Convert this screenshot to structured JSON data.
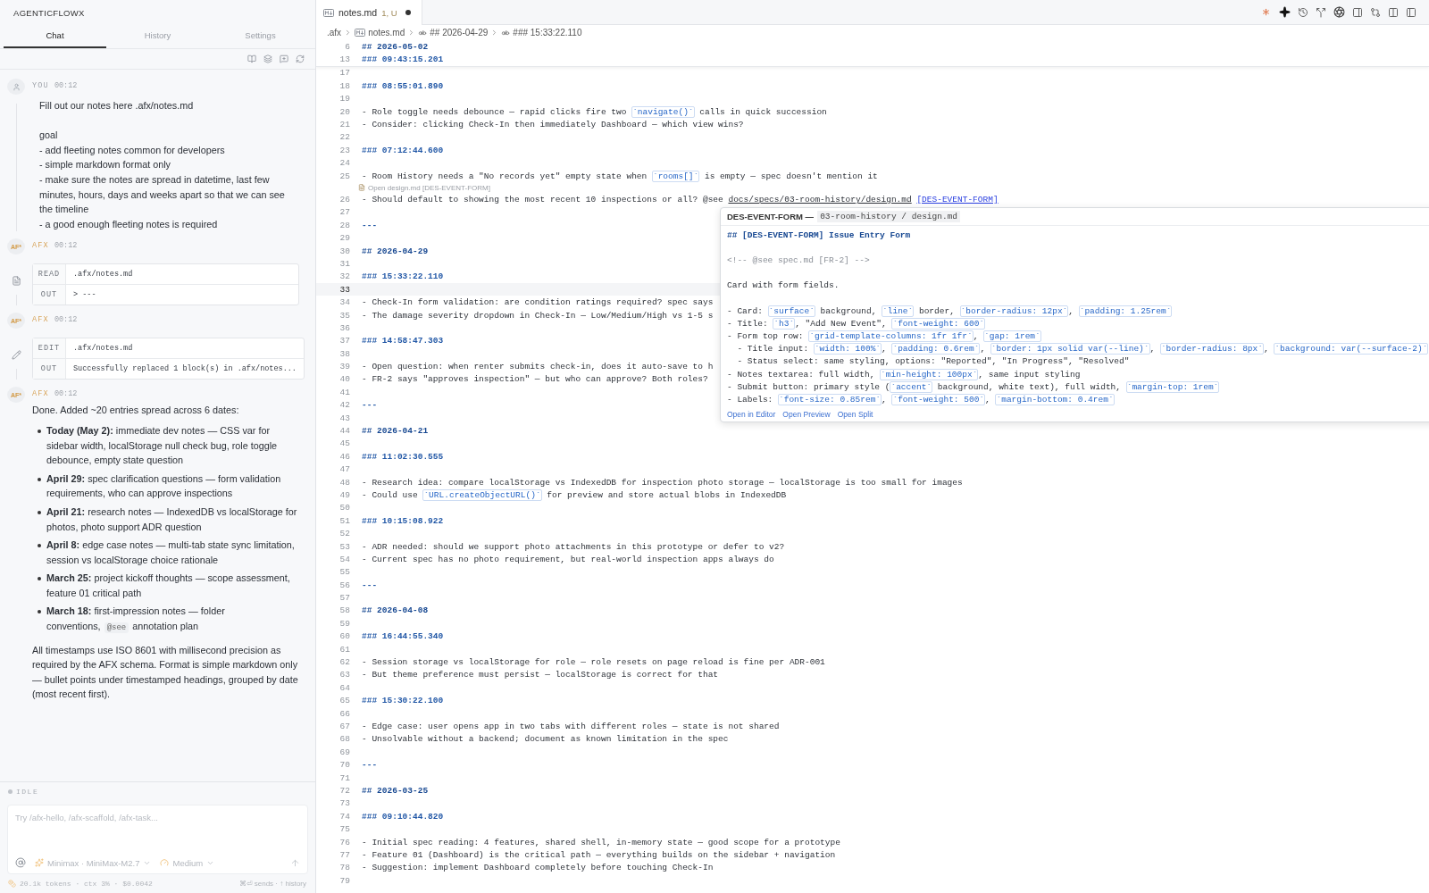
{
  "sidebar": {
    "title": "AGENTICFLOWX",
    "tabs": [
      {
        "label": "Chat",
        "selected": true
      },
      {
        "label": "History",
        "selected": false
      },
      {
        "label": "Settings",
        "selected": false
      }
    ],
    "messages": [
      {
        "kind": "user",
        "role": "YOU",
        "time": "00:12",
        "text": "Fill out our notes here .afx/notes.md\n\ngoal\n- add fleeting notes common for developers\n- simple markdown format only\n- make sure the notes are spread in datetime, last few minutes, hours, days and weeks apart so that we can see the timeline\n- a good enough fleeting notes is required"
      },
      {
        "kind": "read",
        "role": "AFX",
        "time": "00:12",
        "avatar": "AF*",
        "rows": [
          {
            "label": "READ",
            "value": ".afx/notes.md"
          },
          {
            "label": "OUT",
            "value": "> ---"
          }
        ]
      },
      {
        "kind": "edit",
        "role": "AFX",
        "time": "00:12",
        "avatar": "AF*",
        "rows": [
          {
            "label": "EDIT",
            "value": ".afx/notes.md"
          },
          {
            "label": "OUT",
            "value": "Successfully replaced 1 block(s) in .afx/notes..."
          }
        ]
      },
      {
        "kind": "assistant",
        "role": "AFX",
        "time": "00:12",
        "avatar": "AF*",
        "intro": "Done. Added ~20 entries spread across 6 dates:",
        "bullets": [
          {
            "parts": [
              {
                "kind": "text",
                "text": "**Today (May 2):** immediate dev notes — CSS var for sidebar width, localStorage null check bug, role toggle debounce, empty state question"
              }
            ]
          },
          {
            "parts": [
              {
                "kind": "text",
                "text": "**April 29:** spec clarification questions — form validation requirements, who can approve inspections"
              }
            ]
          },
          {
            "parts": [
              {
                "kind": "text",
                "text": "**April 21:** research notes — IndexedDB vs localStorage for photos, photo support ADR question"
              }
            ]
          },
          {
            "parts": [
              {
                "kind": "text",
                "text": "**April 8:** edge case notes — multi-tab state sync limitation, session vs localStorage choice rationale"
              }
            ]
          },
          {
            "parts": [
              {
                "kind": "text",
                "text": "**March 25:** project kickoff thoughts — scope assessment, feature 01 critical path"
              }
            ]
          },
          {
            "parts": [
              {
                "kind": "text",
                "text": "**March 18:** first-impression notes — folder conventions,"
              },
              {
                "kind": "code",
                "text": "@see"
              },
              {
                "kind": "text",
                "text": "annotation plan"
              }
            ]
          }
        ],
        "outro": "All timestamps use ISO 8601 with millisecond precision as required by the AFX schema. Format is simple markdown only — bullet points under timestamped headings, grouped by date (most recent first)."
      }
    ],
    "status": "IDLE",
    "composer": {
      "placeholder": "Try /afx-hello, /afx-scaffold, /afx-task...",
      "model": "Minimax · MiniMax-M2.7",
      "effort": "Medium"
    },
    "footer": {
      "usage": "20.1k tokens · ctx 3% · $0.0042",
      "hint": "⌘⏎ sends · ↑ history"
    }
  },
  "editor": {
    "tab": {
      "name": "notes.md",
      "status": "1, U",
      "modified": true
    },
    "breadcrumb": [
      {
        "kind": "folder",
        "text": ".afx"
      },
      {
        "kind": "file",
        "text": "notes.md"
      },
      {
        "kind": "symbol",
        "text": "## 2026-04-29"
      },
      {
        "kind": "symbol",
        "text": "### 15:33:22.110"
      }
    ],
    "sticky_lines": [
      {
        "n": "6",
        "parts": [
          {
            "kind": "h2",
            "text": "## 2026-05-02"
          }
        ]
      },
      {
        "n": "13",
        "parts": [
          {
            "kind": "h3",
            "text": "### 09:43:15.201"
          }
        ]
      }
    ],
    "lines": [
      {
        "n": "17",
        "current": false
      },
      {
        "n": "18",
        "current": false,
        "parts": [
          {
            "kind": "h3",
            "text": "### 08:55:01.890"
          }
        ]
      },
      {
        "n": "19",
        "current": false
      },
      {
        "n": "20",
        "current": false,
        "parts": [
          {
            "kind": "text",
            "text": "- Role toggle needs debounce — rapid clicks fire two "
          },
          {
            "kind": "code",
            "text": "`navigate()`"
          },
          {
            "kind": "text",
            "text": " calls in quick succession"
          }
        ]
      },
      {
        "n": "21",
        "current": false,
        "parts": [
          {
            "kind": "text",
            "text": "- Consider: clicking Check-In then immediately Dashboard — which view wins?"
          }
        ]
      },
      {
        "n": "22",
        "current": false
      },
      {
        "n": "23",
        "current": false,
        "parts": [
          {
            "kind": "h3",
            "text": "### 07:12:44.600"
          }
        ]
      },
      {
        "n": "24",
        "current": false
      },
      {
        "n": "25",
        "current": false,
        "parts": [
          {
            "kind": "text",
            "text": "- Room History needs a \"No records yet\" empty state when "
          },
          {
            "kind": "code",
            "text": "`rooms[]`"
          },
          {
            "kind": "text",
            "text": " is empty — spec doesn't mention it"
          }
        ]
      },
      {
        "n": "26",
        "current": false,
        "lens": "Open design.md [DES-EVENT-FORM]",
        "parts": [
          {
            "kind": "text",
            "text": "- Should default to showing the most recent 10 inspections or all? @see "
          },
          {
            "kind": "path",
            "text": "docs/specs/03-room-history/design.md"
          },
          {
            "kind": "ref",
            "text": "[DES-EVENT-FORM]"
          }
        ]
      },
      {
        "n": "27",
        "current": false
      },
      {
        "n": "28",
        "current": false,
        "parts": [
          {
            "kind": "hr",
            "text": "---"
          }
        ]
      },
      {
        "n": "29",
        "current": false
      },
      {
        "n": "30",
        "current": false,
        "parts": [
          {
            "kind": "h2",
            "text": "## 2026-04-29"
          }
        ]
      },
      {
        "n": "31",
        "current": false
      },
      {
        "n": "32",
        "current": false,
        "parts": [
          {
            "kind": "h3",
            "text": "### 15:33:22.110"
          }
        ]
      },
      {
        "n": "33",
        "current": true
      },
      {
        "n": "34",
        "current": false,
        "parts": [
          {
            "kind": "text",
            "text": "- Check-In form validation: are condition ratings required? spec says"
          }
        ]
      },
      {
        "n": "35",
        "current": false,
        "parts": [
          {
            "kind": "text",
            "text": "- The damage severity dropdown in Check-In — Low/Medium/High vs 1-5 s"
          }
        ]
      },
      {
        "n": "36",
        "current": false
      },
      {
        "n": "37",
        "current": false,
        "parts": [
          {
            "kind": "h3",
            "text": "### 14:58:47.303"
          }
        ]
      },
      {
        "n": "38",
        "current": false
      },
      {
        "n": "39",
        "current": false,
        "parts": [
          {
            "kind": "text",
            "text": "- Open question: when renter submits check-in, does it auto-save to h"
          }
        ]
      },
      {
        "n": "40",
        "current": false,
        "parts": [
          {
            "kind": "text",
            "text": "- FR-2 says \"approves inspection\" — but who can approve? Both roles?"
          }
        ]
      },
      {
        "n": "41",
        "current": false
      },
      {
        "n": "42",
        "current": false,
        "parts": [
          {
            "kind": "hr",
            "text": "---"
          }
        ]
      },
      {
        "n": "43",
        "current": false
      },
      {
        "n": "44",
        "current": false,
        "parts": [
          {
            "kind": "h2",
            "text": "## 2026-04-21"
          }
        ]
      },
      {
        "n": "45",
        "current": false
      },
      {
        "n": "46",
        "current": false,
        "parts": [
          {
            "kind": "h3",
            "text": "### 11:02:30.555"
          }
        ]
      },
      {
        "n": "47",
        "current": false
      },
      {
        "n": "48",
        "current": false,
        "parts": [
          {
            "kind": "text",
            "text": "- Research idea: compare localStorage vs IndexedDB for inspection photo storage — localStorage is too small for images"
          }
        ]
      },
      {
        "n": "49",
        "current": false,
        "parts": [
          {
            "kind": "text",
            "text": "- Could use "
          },
          {
            "kind": "code",
            "text": "`URL.createObjectURL()`"
          },
          {
            "kind": "text",
            "text": " for preview and store actual blobs in IndexedDB"
          }
        ]
      },
      {
        "n": "50",
        "current": false
      },
      {
        "n": "51",
        "current": false,
        "parts": [
          {
            "kind": "h3",
            "text": "### 10:15:08.922"
          }
        ]
      },
      {
        "n": "52",
        "current": false
      },
      {
        "n": "53",
        "current": false,
        "parts": [
          {
            "kind": "text",
            "text": "- ADR needed: should we support photo attachments in this prototype or defer to v2?"
          }
        ]
      },
      {
        "n": "54",
        "current": false,
        "parts": [
          {
            "kind": "text",
            "text": "- Current spec has no photo requirement, but real-world inspection apps always do"
          }
        ]
      },
      {
        "n": "55",
        "current": false
      },
      {
        "n": "56",
        "current": false,
        "parts": [
          {
            "kind": "hr",
            "text": "---"
          }
        ]
      },
      {
        "n": "57",
        "current": false
      },
      {
        "n": "58",
        "current": false,
        "parts": [
          {
            "kind": "h2",
            "text": "## 2026-04-08"
          }
        ]
      },
      {
        "n": "59",
        "current": false
      },
      {
        "n": "60",
        "current": false,
        "parts": [
          {
            "kind": "h3",
            "text": "### 16:44:55.340"
          }
        ]
      },
      {
        "n": "61",
        "current": false
      },
      {
        "n": "62",
        "current": false,
        "parts": [
          {
            "kind": "text",
            "text": "- Session storage vs localStorage for role — role resets on page reload is fine per ADR-001"
          }
        ]
      },
      {
        "n": "63",
        "current": false,
        "parts": [
          {
            "kind": "text",
            "text": "- But theme preference must persist — localStorage is correct for that"
          }
        ]
      },
      {
        "n": "64",
        "current": false
      },
      {
        "n": "65",
        "current": false,
        "parts": [
          {
            "kind": "h3",
            "text": "### 15:30:22.100"
          }
        ]
      },
      {
        "n": "66",
        "current": false
      },
      {
        "n": "67",
        "current": false,
        "parts": [
          {
            "kind": "text",
            "text": "- Edge case: user opens app in two tabs with different roles — state is not shared"
          }
        ]
      },
      {
        "n": "68",
        "current": false,
        "parts": [
          {
            "kind": "text",
            "text": "- Unsolvable without a backend; document as known limitation in the spec"
          }
        ]
      },
      {
        "n": "69",
        "current": false
      },
      {
        "n": "70",
        "current": false,
        "parts": [
          {
            "kind": "hr",
            "text": "---"
          }
        ]
      },
      {
        "n": "71",
        "current": false
      },
      {
        "n": "72",
        "current": false,
        "parts": [
          {
            "kind": "h2",
            "text": "## 2026-03-25"
          }
        ]
      },
      {
        "n": "73",
        "current": false
      },
      {
        "n": "74",
        "current": false,
        "parts": [
          {
            "kind": "h3",
            "text": "### 09:10:44.820"
          }
        ]
      },
      {
        "n": "75",
        "current": false
      },
      {
        "n": "76",
        "current": false,
        "parts": [
          {
            "kind": "text",
            "text": "- Initial spec reading: 4 features, shared shell, in-memory state — good scope for a prototype"
          }
        ]
      },
      {
        "n": "77",
        "current": false,
        "parts": [
          {
            "kind": "text",
            "text": "- Feature 01 (Dashboard) is the critical path — everything builds on the sidebar + navigation"
          }
        ]
      },
      {
        "n": "78",
        "current": false,
        "parts": [
          {
            "kind": "text",
            "text": "- Suggestion: implement Dashboard completely before touching Check-In"
          }
        ]
      },
      {
        "n": "79",
        "current": false
      }
    ],
    "hover": {
      "title": "DES-EVENT-FORM —",
      "path": "03-room-history / design.md",
      "lines": [
        {
          "kind": "content",
          "parts": [
            {
              "kind": "h2",
              "text": "## [DES-EVENT-FORM] Issue Entry Form"
            }
          ]
        },
        {
          "kind": "blank"
        },
        {
          "kind": "content",
          "parts": [
            {
              "kind": "comment",
              "text": "<!-- @see spec.md [FR-2] -->"
            }
          ]
        },
        {
          "kind": "blank"
        },
        {
          "kind": "content",
          "parts": [
            {
              "kind": "text",
              "text": "Card with form fields."
            }
          ]
        },
        {
          "kind": "blank"
        },
        {
          "kind": "content",
          "parts": [
            {
              "kind": "text",
              "text": "- Card: "
            },
            {
              "kind": "code",
              "text": "`surface`"
            },
            {
              "kind": "text",
              "text": " background, "
            },
            {
              "kind": "code",
              "text": "`line`"
            },
            {
              "kind": "text",
              "text": " border, "
            },
            {
              "kind": "code",
              "text": "`border-radius: 12px`"
            },
            {
              "kind": "text",
              "text": ", "
            },
            {
              "kind": "code",
              "text": "`padding: 1.25rem`"
            }
          ]
        },
        {
          "kind": "content",
          "parts": [
            {
              "kind": "text",
              "text": "- Title: "
            },
            {
              "kind": "code",
              "text": "`h3`"
            },
            {
              "kind": "text",
              "text": ", \"Add New Event\", "
            },
            {
              "kind": "code",
              "text": "`font-weight: 600`"
            }
          ]
        },
        {
          "kind": "content",
          "parts": [
            {
              "kind": "text",
              "text": "- Form top row: "
            },
            {
              "kind": "code",
              "text": "`grid-template-columns: 1fr 1fr`"
            },
            {
              "kind": "text",
              "text": ", "
            },
            {
              "kind": "code",
              "text": "`gap: 1rem`"
            }
          ]
        },
        {
          "kind": "content",
          "parts": [
            {
              "kind": "text",
              "text": "  - Title input: "
            },
            {
              "kind": "code",
              "text": "`width: 100%`"
            },
            {
              "kind": "text",
              "text": ", "
            },
            {
              "kind": "code",
              "text": "`padding: 0.6rem`"
            },
            {
              "kind": "text",
              "text": ", "
            },
            {
              "kind": "code",
              "text": "`border: 1px solid var(--line)`"
            },
            {
              "kind": "text",
              "text": ", "
            },
            {
              "kind": "code",
              "text": "`border-radius: 8px`"
            },
            {
              "kind": "text",
              "text": ", "
            },
            {
              "kind": "code",
              "text": "`background: var(--surface-2)`"
            }
          ]
        },
        {
          "kind": "content",
          "parts": [
            {
              "kind": "text",
              "text": "  - Status select: same styling, options: \"Reported\", \"In Progress\", \"Resolved\""
            }
          ]
        },
        {
          "kind": "content",
          "parts": [
            {
              "kind": "text",
              "text": "- Notes textarea: full width, "
            },
            {
              "kind": "code",
              "text": "`min-height: 100px`"
            },
            {
              "kind": "text",
              "text": ", same input styling"
            }
          ]
        },
        {
          "kind": "content",
          "parts": [
            {
              "kind": "text",
              "text": "- Submit button: primary style ("
            },
            {
              "kind": "code",
              "text": "`accent`"
            },
            {
              "kind": "text",
              "text": " background, white text), full width, "
            },
            {
              "kind": "code",
              "text": "`margin-top: 1rem`"
            }
          ]
        },
        {
          "kind": "content",
          "parts": [
            {
              "kind": "text",
              "text": "- Labels: "
            },
            {
              "kind": "code",
              "text": "`font-size: 0.85rem`"
            },
            {
              "kind": "text",
              "text": ", "
            },
            {
              "kind": "code",
              "text": "`font-weight: 500`"
            },
            {
              "kind": "text",
              "text": ", "
            },
            {
              "kind": "code",
              "text": "`margin-bottom: 0.4rem`"
            }
          ]
        }
      ],
      "actions": [
        "Open in Editor",
        "Open Preview",
        "Open Split"
      ]
    }
  }
}
